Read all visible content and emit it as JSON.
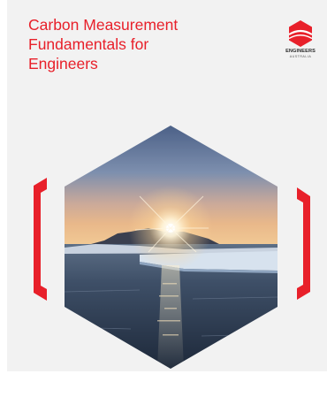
{
  "cover": {
    "title_lines": [
      "Carbon Measurement",
      "Fundamentals for",
      "Engineers"
    ],
    "logo": {
      "icon": "engineers-australia-hexagon-logo-icon",
      "name": "ENGINEERS",
      "sub": "AUSTRALIA"
    },
    "image": {
      "subject": "sunset-over-icy-sea-photo",
      "frame_icons": [
        "left-red-bracket-icon",
        "right-red-bracket-icon"
      ]
    },
    "colors": {
      "accent_red": "#e8202a",
      "background": "#f2f2f2"
    }
  }
}
